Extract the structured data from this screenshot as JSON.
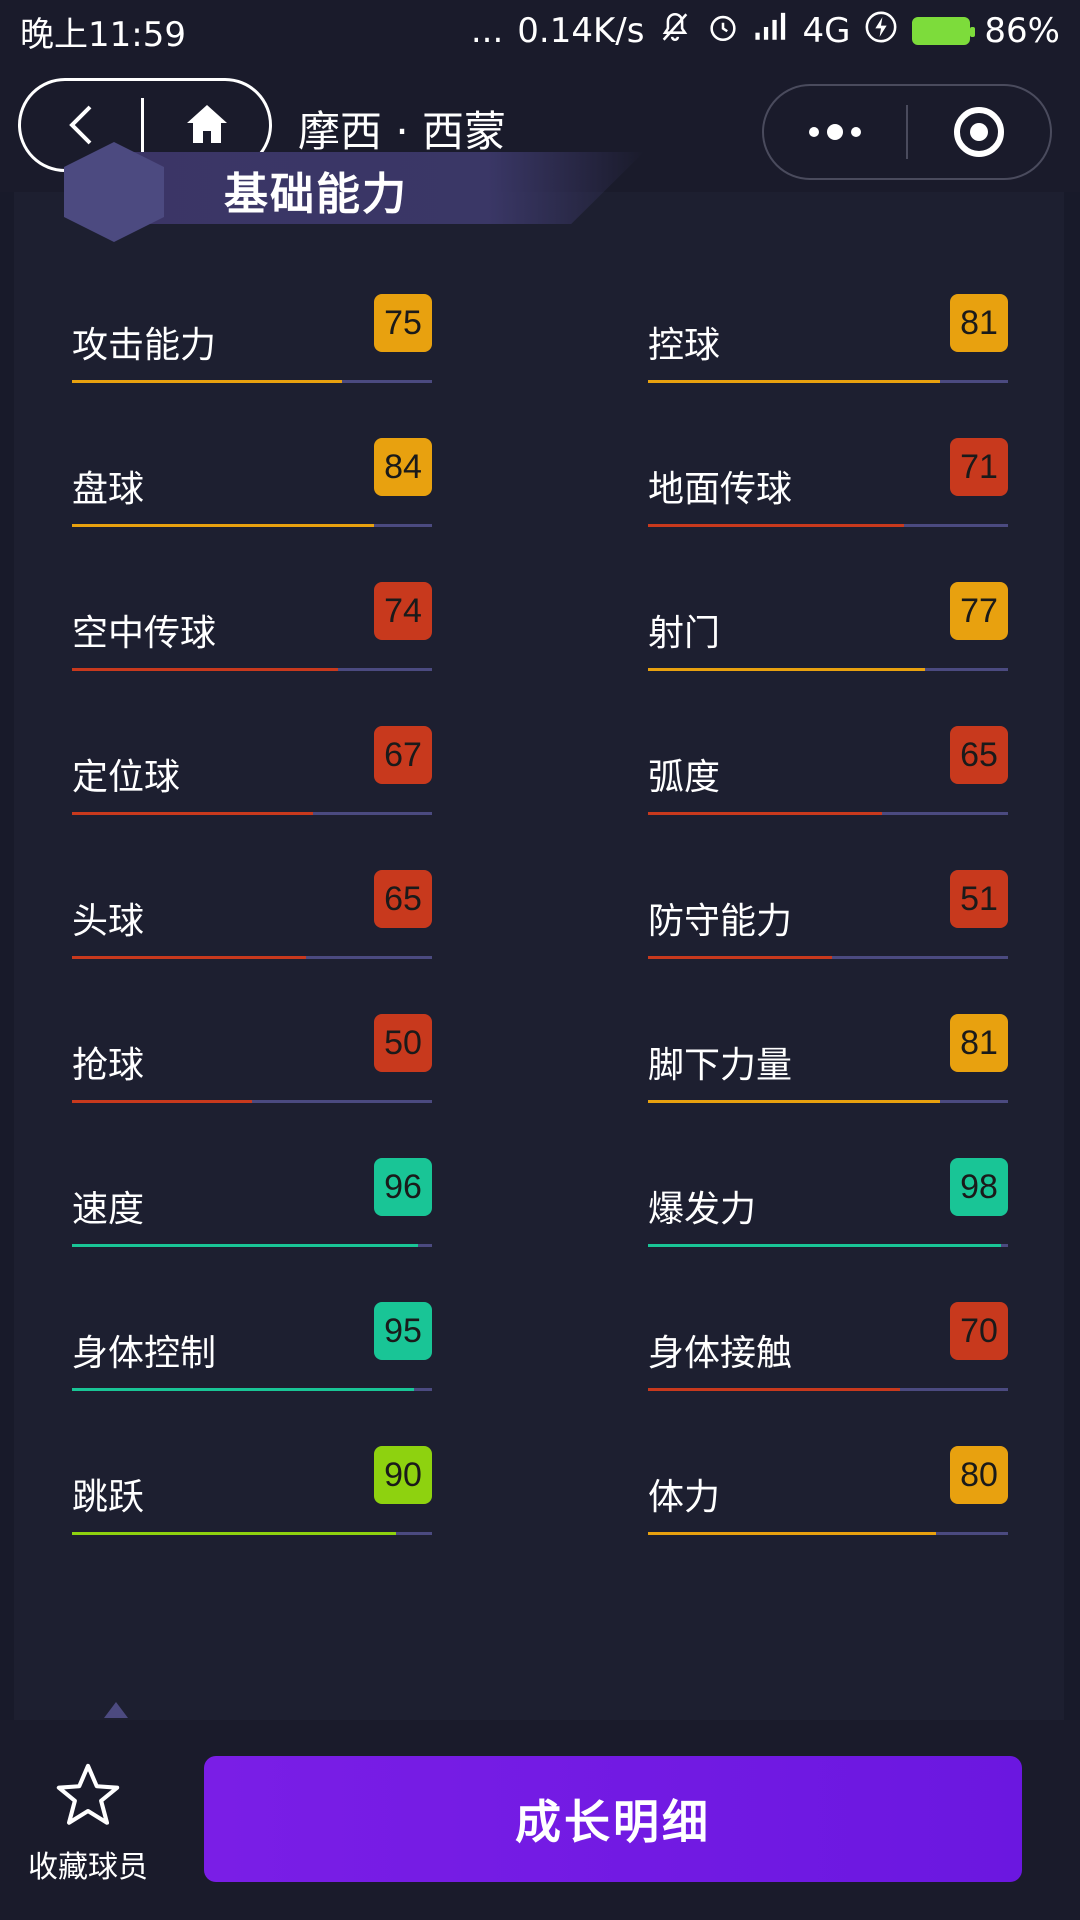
{
  "status_bar": {
    "time": "晚上11:59",
    "dots": "...",
    "speed": "0.14K/s",
    "network": "4G",
    "battery": "86%",
    "icons": [
      "mute-icon",
      "alarm-icon",
      "signal-icon",
      "flash-icon",
      "battery-icon"
    ]
  },
  "nav": {
    "title": "摩西 · 西蒙",
    "back_icon": "back-chevron-icon",
    "home_icon": "home-icon",
    "more_icon": "more-dots-icon",
    "close_icon": "close-ring-icon"
  },
  "section": {
    "title": "基础能力"
  },
  "colors": {
    "orange": "#e8a10f",
    "red": "#c8391d",
    "teal": "#19c596",
    "lime": "#8ed20f",
    "track": "#4b4a80",
    "button": "#7a1ee6"
  },
  "stats_left": [
    {
      "label": "攻击能力",
      "value": 75,
      "color": "#e8a10f"
    },
    {
      "label": "盘球",
      "value": 84,
      "color": "#e8a10f"
    },
    {
      "label": "空中传球",
      "value": 74,
      "color": "#c8391d"
    },
    {
      "label": "定位球",
      "value": 67,
      "color": "#c8391d"
    },
    {
      "label": "头球",
      "value": 65,
      "color": "#c8391d"
    },
    {
      "label": "抢球",
      "value": 50,
      "color": "#c8391d"
    },
    {
      "label": "速度",
      "value": 96,
      "color": "#19c596"
    },
    {
      "label": "身体控制",
      "value": 95,
      "color": "#19c596"
    },
    {
      "label": "跳跃",
      "value": 90,
      "color": "#8ed20f"
    }
  ],
  "stats_right": [
    {
      "label": "控球",
      "value": 81,
      "color": "#e8a10f"
    },
    {
      "label": "地面传球",
      "value": 71,
      "color": "#c8391d"
    },
    {
      "label": "射门",
      "value": 77,
      "color": "#e8a10f"
    },
    {
      "label": "弧度",
      "value": 65,
      "color": "#c8391d"
    },
    {
      "label": "防守能力",
      "value": 51,
      "color": "#c8391d"
    },
    {
      "label": "脚下力量",
      "value": 81,
      "color": "#e8a10f"
    },
    {
      "label": "爆发力",
      "value": 98,
      "color": "#19c596"
    },
    {
      "label": "身体接触",
      "value": 70,
      "color": "#c8391d"
    },
    {
      "label": "体力",
      "value": 80,
      "color": "#e8a10f"
    }
  ],
  "bottom": {
    "favorite_label": "收藏球员",
    "favorite_icon": "star-icon",
    "growth_button": "成长明细"
  }
}
